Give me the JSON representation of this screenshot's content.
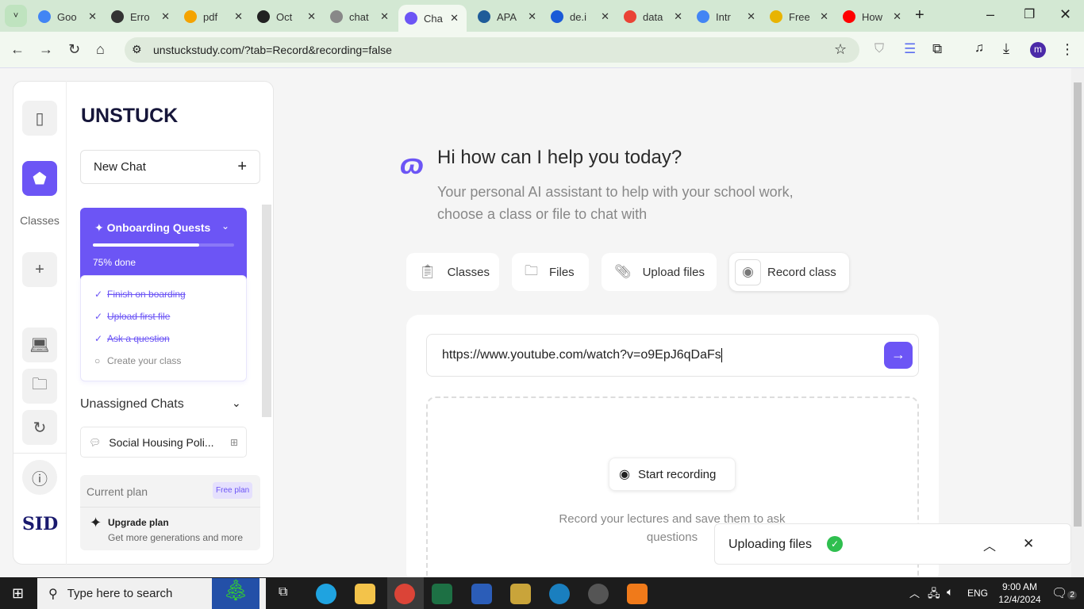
{
  "browser": {
    "tabs": [
      {
        "label": "Goo",
        "color": "#4285f4"
      },
      {
        "label": "Erro",
        "color": "#333"
      },
      {
        "label": "pdf",
        "color": "#f4a300"
      },
      {
        "label": "Oct",
        "color": "#222"
      },
      {
        "label": "chat",
        "color": "#888"
      },
      {
        "label": "Cha",
        "color": "#6c55f5",
        "active": true
      },
      {
        "label": "APA",
        "color": "#1f5c99"
      },
      {
        "label": "de.i",
        "color": "#1a5ad7"
      },
      {
        "label": "data",
        "color": "#ea4335"
      },
      {
        "label": "Intr",
        "color": "#4285f4"
      },
      {
        "label": "Free",
        "color": "#e8b400"
      },
      {
        "label": "How",
        "color": "#ff0000"
      }
    ],
    "url": "unstuckstudy.com/?tab=Record&recording=false",
    "profile_initial": "m"
  },
  "sidebar": {
    "rail_label_classes": "Classes",
    "logo": "UNSTUCK",
    "new_chat": "New Chat",
    "quests": {
      "title": "Onboarding Quests",
      "progress_percent": 75,
      "progress_label": "75% done",
      "items": [
        {
          "label": "Finish on boarding",
          "done": true
        },
        {
          "label": "Upload first file",
          "done": true
        },
        {
          "label": "Ask a question",
          "done": true
        },
        {
          "label": "Create your class",
          "done": false
        }
      ]
    },
    "unassigned_title": "Unassigned Chats",
    "chats": [
      {
        "label": "Social Housing Poli..."
      }
    ],
    "plan": {
      "label": "Current plan",
      "badge": "Free plan",
      "upgrade_title": "Upgrade plan",
      "upgrade_sub": "Get more generations and more"
    },
    "brand_footer": "SID"
  },
  "main": {
    "heading": "Hi how can I help you today?",
    "subtitle_line1": "Your personal AI assistant to help with your school work,",
    "subtitle_line2": "choose a class or file to chat with",
    "buttons": [
      {
        "label": "Classes",
        "icon": "clipboard-icon"
      },
      {
        "label": "Files",
        "icon": "folder-icon"
      },
      {
        "label": "Upload files",
        "icon": "paperclip-icon"
      },
      {
        "label": "Record class",
        "icon": "record-icon"
      }
    ],
    "url_input": "https://www.youtube.com/watch?v=o9EpJ6qDaFs",
    "start_recording": "Start recording",
    "record_hint": "Record your lectures and save them to ask questions"
  },
  "toast": {
    "label": "Uploading files",
    "status_color": "#2fbf4f"
  },
  "accent": "#6c55f5",
  "taskbar": {
    "search_placeholder": "Type here to search",
    "lang": "ENG",
    "time": "9:00 AM",
    "date": "12/4/2024",
    "notifications": "2"
  }
}
